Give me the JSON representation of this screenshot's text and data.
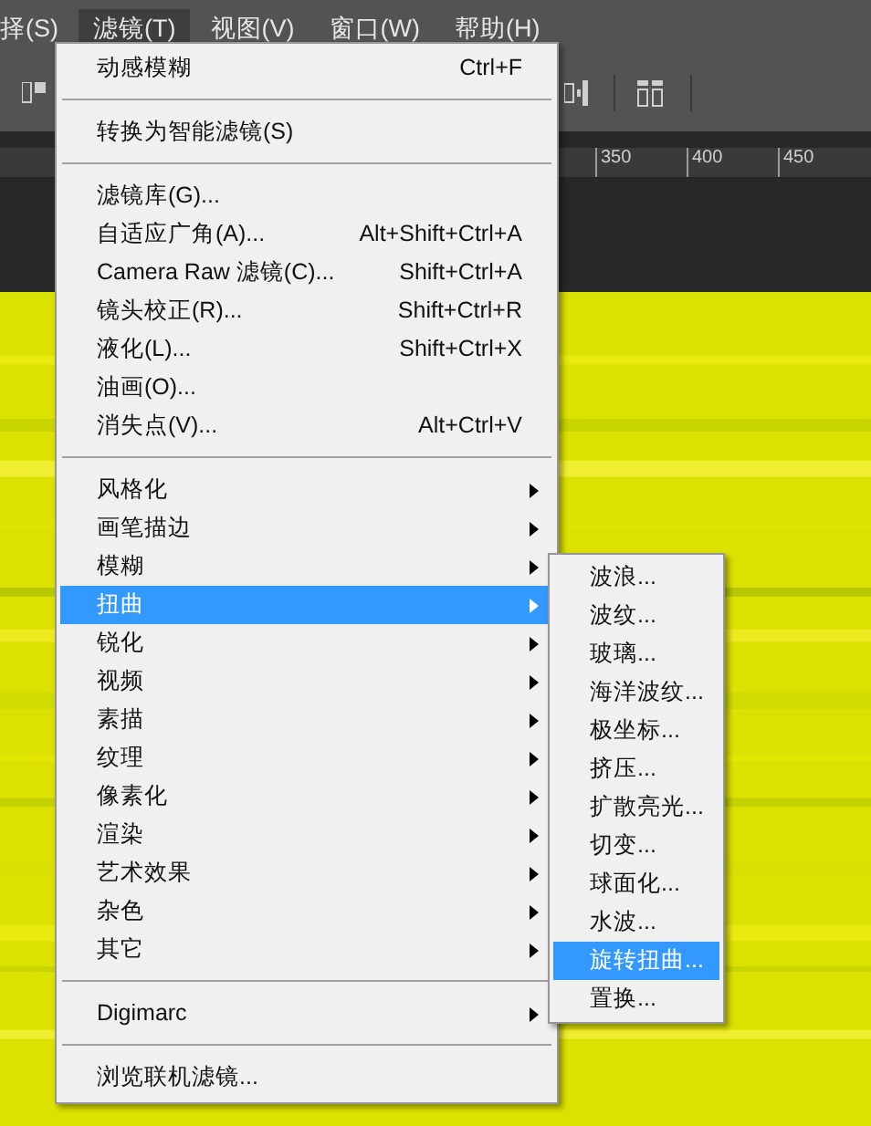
{
  "menubar": [
    {
      "label": "择(S)",
      "selected": false
    },
    {
      "label": "滤镜(T)",
      "selected": true
    },
    {
      "label": "视图(V)",
      "selected": false
    },
    {
      "label": "窗口(W)",
      "selected": false
    },
    {
      "label": "帮助(H)",
      "selected": false
    }
  ],
  "ruler": {
    "labels": [
      "350",
      "400",
      "450"
    ]
  },
  "filter_menu": {
    "items": [
      {
        "kind": "item",
        "label": "动感模糊",
        "shortcut": "Ctrl+F"
      },
      {
        "kind": "separator"
      },
      {
        "kind": "item",
        "label": "转换为智能滤镜(S)"
      },
      {
        "kind": "separator"
      },
      {
        "kind": "item",
        "label": "滤镜库(G)..."
      },
      {
        "kind": "item",
        "label": "自适应广角(A)...",
        "shortcut": "Alt+Shift+Ctrl+A"
      },
      {
        "kind": "item",
        "label": "Camera Raw 滤镜(C)...",
        "shortcut": "Shift+Ctrl+A"
      },
      {
        "kind": "item",
        "label": "镜头校正(R)...",
        "shortcut": "Shift+Ctrl+R"
      },
      {
        "kind": "item",
        "label": "液化(L)...",
        "shortcut": "Shift+Ctrl+X"
      },
      {
        "kind": "item",
        "label": "油画(O)..."
      },
      {
        "kind": "item",
        "label": "消失点(V)...",
        "shortcut": "Alt+Ctrl+V"
      },
      {
        "kind": "separator"
      },
      {
        "kind": "submenu",
        "label": "风格化",
        "selected": false
      },
      {
        "kind": "submenu",
        "label": "画笔描边",
        "selected": false
      },
      {
        "kind": "submenu",
        "label": "模糊",
        "selected": false
      },
      {
        "kind": "submenu",
        "label": "扭曲",
        "selected": true
      },
      {
        "kind": "submenu",
        "label": "锐化",
        "selected": false
      },
      {
        "kind": "submenu",
        "label": "视频",
        "selected": false
      },
      {
        "kind": "submenu",
        "label": "素描",
        "selected": false
      },
      {
        "kind": "submenu",
        "label": "纹理",
        "selected": false
      },
      {
        "kind": "submenu",
        "label": "像素化",
        "selected": false
      },
      {
        "kind": "submenu",
        "label": "渲染",
        "selected": false
      },
      {
        "kind": "submenu",
        "label": "艺术效果",
        "selected": false
      },
      {
        "kind": "submenu",
        "label": "杂色",
        "selected": false
      },
      {
        "kind": "submenu",
        "label": "其它",
        "selected": false
      },
      {
        "kind": "separator"
      },
      {
        "kind": "submenu",
        "label": "Digimarc",
        "selected": false
      },
      {
        "kind": "separator"
      },
      {
        "kind": "item",
        "label": "浏览联机滤镜..."
      }
    ]
  },
  "distort_submenu": {
    "items": [
      {
        "label": "波浪...",
        "selected": false
      },
      {
        "label": "波纹...",
        "selected": false
      },
      {
        "label": "玻璃...",
        "selected": false
      },
      {
        "label": "海洋波纹...",
        "selected": false
      },
      {
        "label": "极坐标...",
        "selected": false
      },
      {
        "label": "挤压...",
        "selected": false
      },
      {
        "label": "扩散亮光...",
        "selected": false
      },
      {
        "label": "切变...",
        "selected": false
      },
      {
        "label": "球面化...",
        "selected": false
      },
      {
        "label": "水波...",
        "selected": false
      },
      {
        "label": "旋转扭曲...",
        "selected": true
      },
      {
        "label": "置换...",
        "selected": false
      }
    ]
  }
}
